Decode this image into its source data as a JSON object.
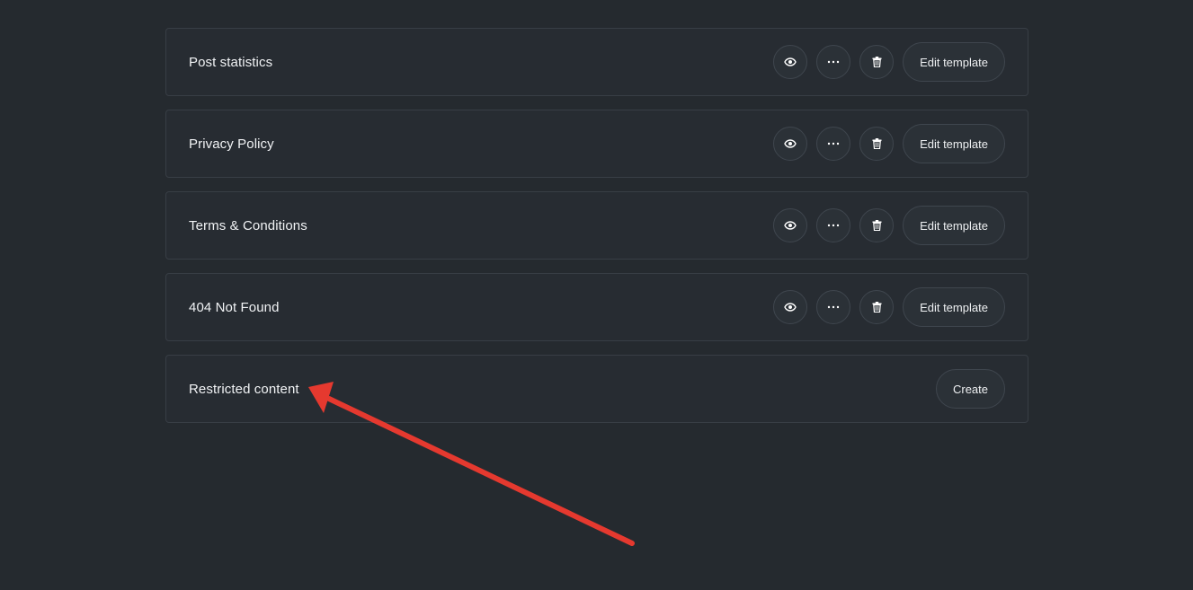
{
  "templates": [
    {
      "title": "Post statistics",
      "action_label": "Edit template"
    },
    {
      "title": "Privacy Policy",
      "action_label": "Edit template"
    },
    {
      "title": "Terms & Conditions",
      "action_label": "Edit template"
    },
    {
      "title": "404 Not Found",
      "action_label": "Edit template"
    },
    {
      "title": "Restricted content",
      "action_label": "Create"
    }
  ],
  "icons": {
    "preview": "eye-icon",
    "more": "more-horizontal-icon",
    "delete": "trash-icon"
  },
  "annotation": {
    "type": "arrow",
    "color": "#e5392f",
    "points_to": "Restricted content"
  }
}
